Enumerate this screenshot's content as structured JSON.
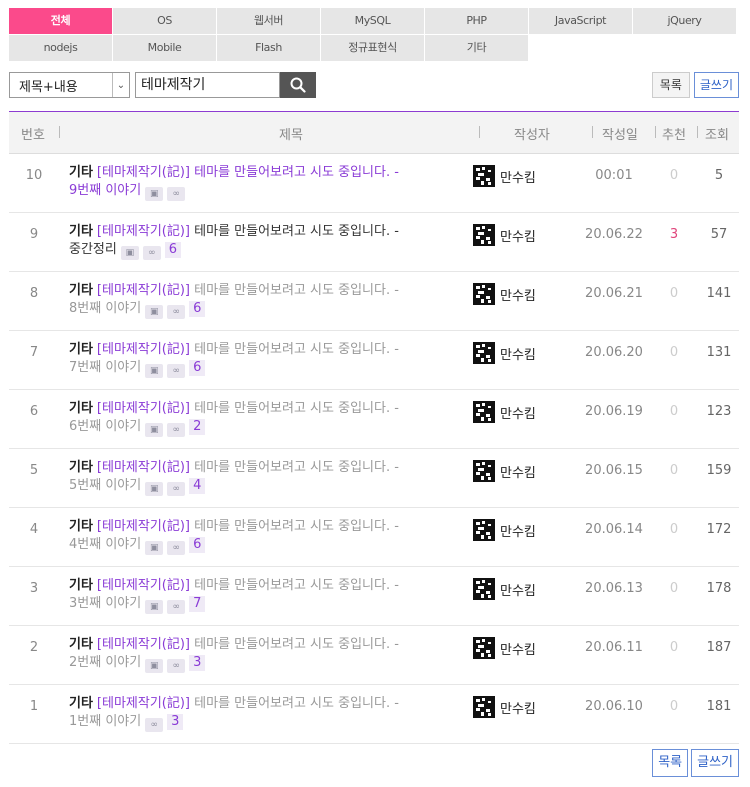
{
  "categories": [
    [
      "전체",
      "OS",
      "웹서버",
      "MySQL",
      "PHP",
      "JavaScript",
      "jQuery"
    ],
    [
      "nodejs",
      "Mobile",
      "Flash",
      "정규표현식",
      "기타"
    ]
  ],
  "active_category": "전체",
  "search": {
    "field_label": "제목+내용",
    "query": "테마제작기"
  },
  "buttons": {
    "list": "목록",
    "write": "글쓰기"
  },
  "columns": {
    "num": "번호",
    "title": "제목",
    "author": "작성자",
    "date": "작성일",
    "rec": "추천",
    "views": "조회"
  },
  "colors": {
    "accent": "#fb4a8b",
    "purple": "#8a3bd6",
    "link_blue": "#2f62c7"
  },
  "rows": [
    {
      "num": "10",
      "cat": "기타",
      "tag": "[테마제작기(記)]",
      "rest": "테마를 만들어보려고 시도 중입니다. -",
      "line2": "9번째 이야기",
      "icons": [
        "image-icon",
        "link-icon"
      ],
      "comments": "",
      "author": "만수킴",
      "date": "00:01",
      "rec": "0",
      "views": "5"
    },
    {
      "num": "9",
      "cat": "기타",
      "tag": "[테마제작기(記)]",
      "rest": "테마를 만들어보려고 시도 중입니다. -",
      "line2": "중간정리",
      "icons": [
        "image-icon",
        "link-icon"
      ],
      "comments": "6",
      "author": "만수킴",
      "date": "20.06.22",
      "rec": "3",
      "views": "57"
    },
    {
      "num": "8",
      "cat": "기타",
      "tag": "[테마제작기(記)]",
      "rest": "테마를 만들어보려고 시도 중입니다. -",
      "line2": "8번째 이야기",
      "icons": [
        "image-icon",
        "link-icon"
      ],
      "comments": "6",
      "author": "만수킴",
      "date": "20.06.21",
      "rec": "0",
      "views": "141"
    },
    {
      "num": "7",
      "cat": "기타",
      "tag": "[테마제작기(記)]",
      "rest": "테마를 만들어보려고 시도 중입니다. -",
      "line2": "7번째 이야기",
      "icons": [
        "image-icon",
        "link-icon"
      ],
      "comments": "6",
      "author": "만수킴",
      "date": "20.06.20",
      "rec": "0",
      "views": "131"
    },
    {
      "num": "6",
      "cat": "기타",
      "tag": "[테마제작기(記)]",
      "rest": "테마를 만들어보려고 시도 중입니다. -",
      "line2": "6번째 이야기",
      "icons": [
        "image-icon",
        "link-icon"
      ],
      "comments": "2",
      "author": "만수킴",
      "date": "20.06.19",
      "rec": "0",
      "views": "123"
    },
    {
      "num": "5",
      "cat": "기타",
      "tag": "[테마제작기(記)]",
      "rest": "테마를 만들어보려고 시도 중입니다. -",
      "line2": "5번째 이야기",
      "icons": [
        "image-icon",
        "link-icon"
      ],
      "comments": "4",
      "author": "만수킴",
      "date": "20.06.15",
      "rec": "0",
      "views": "159"
    },
    {
      "num": "4",
      "cat": "기타",
      "tag": "[테마제작기(記)]",
      "rest": "테마를 만들어보려고 시도 중입니다. -",
      "line2": "4번째 이야기",
      "icons": [
        "image-icon",
        "link-icon"
      ],
      "comments": "6",
      "author": "만수킴",
      "date": "20.06.14",
      "rec": "0",
      "views": "172"
    },
    {
      "num": "3",
      "cat": "기타",
      "tag": "[테마제작기(記)]",
      "rest": "테마를 만들어보려고 시도 중입니다. -",
      "line2": "3번째 이야기",
      "icons": [
        "image-icon",
        "link-icon"
      ],
      "comments": "7",
      "author": "만수킴",
      "date": "20.06.13",
      "rec": "0",
      "views": "178"
    },
    {
      "num": "2",
      "cat": "기타",
      "tag": "[테마제작기(記)]",
      "rest": "테마를 만들어보려고 시도 중입니다. -",
      "line2": "2번째 이야기",
      "icons": [
        "image-icon",
        "link-icon"
      ],
      "comments": "3",
      "author": "만수킴",
      "date": "20.06.11",
      "rec": "0",
      "views": "187"
    },
    {
      "num": "1",
      "cat": "기타",
      "tag": "[테마제작기(記)]",
      "rest": "테마를 만들어보려고 시도 중입니다. -",
      "line2": "1번째 이야기",
      "icons": [
        "link-icon"
      ],
      "comments": "3",
      "author": "만수킴",
      "date": "20.06.10",
      "rec": "0",
      "views": "181"
    }
  ]
}
